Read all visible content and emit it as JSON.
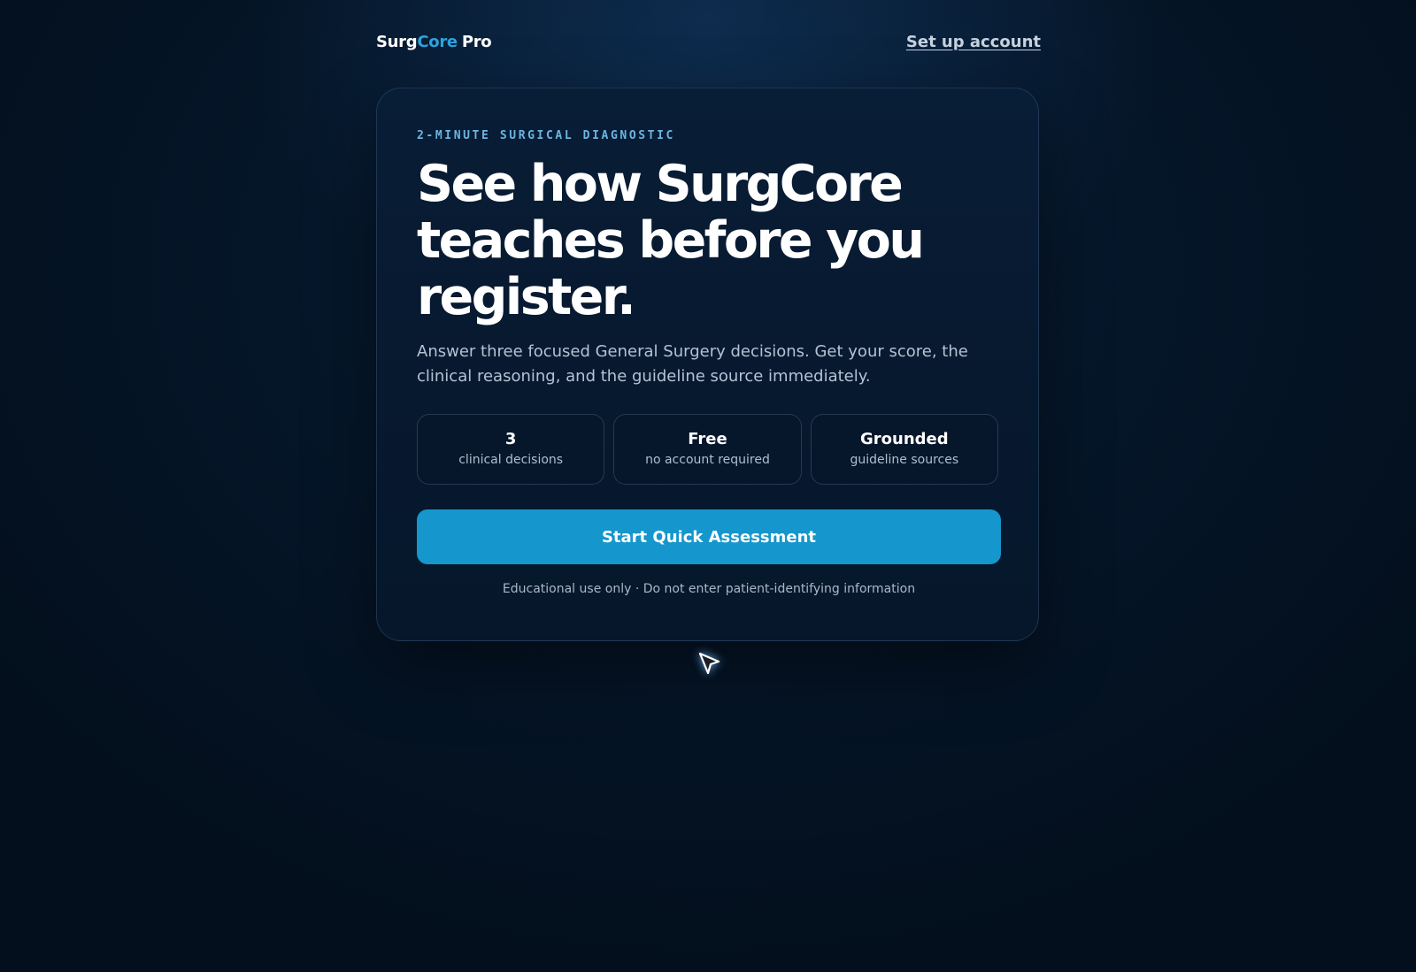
{
  "brand": {
    "part1": "Surg",
    "part2": "Core",
    "part3": "Pro",
    "accent_color": "#2ea4dc"
  },
  "nav": {
    "setup_link": "Set up account"
  },
  "hero": {
    "eyebrow": "2-MINUTE SURGICAL DIAGNOSTIC",
    "headline": "See how SurgCore teaches before you register.",
    "subtitle": "Answer three focused General Surgery decisions. Get your score, the clinical reasoning, and the guideline source immediately."
  },
  "stats": [
    {
      "value": "3",
      "label": "clinical decisions"
    },
    {
      "value": "Free",
      "label": "no account required"
    },
    {
      "value": "Grounded",
      "label": "guideline sources"
    }
  ],
  "cta": {
    "label": "Start Quick Assessment",
    "color": "#1596cc"
  },
  "disclaimer": "Educational use only · Do not enter patient-identifying information",
  "cursor": {
    "icon": "mouse-pointer-icon"
  }
}
